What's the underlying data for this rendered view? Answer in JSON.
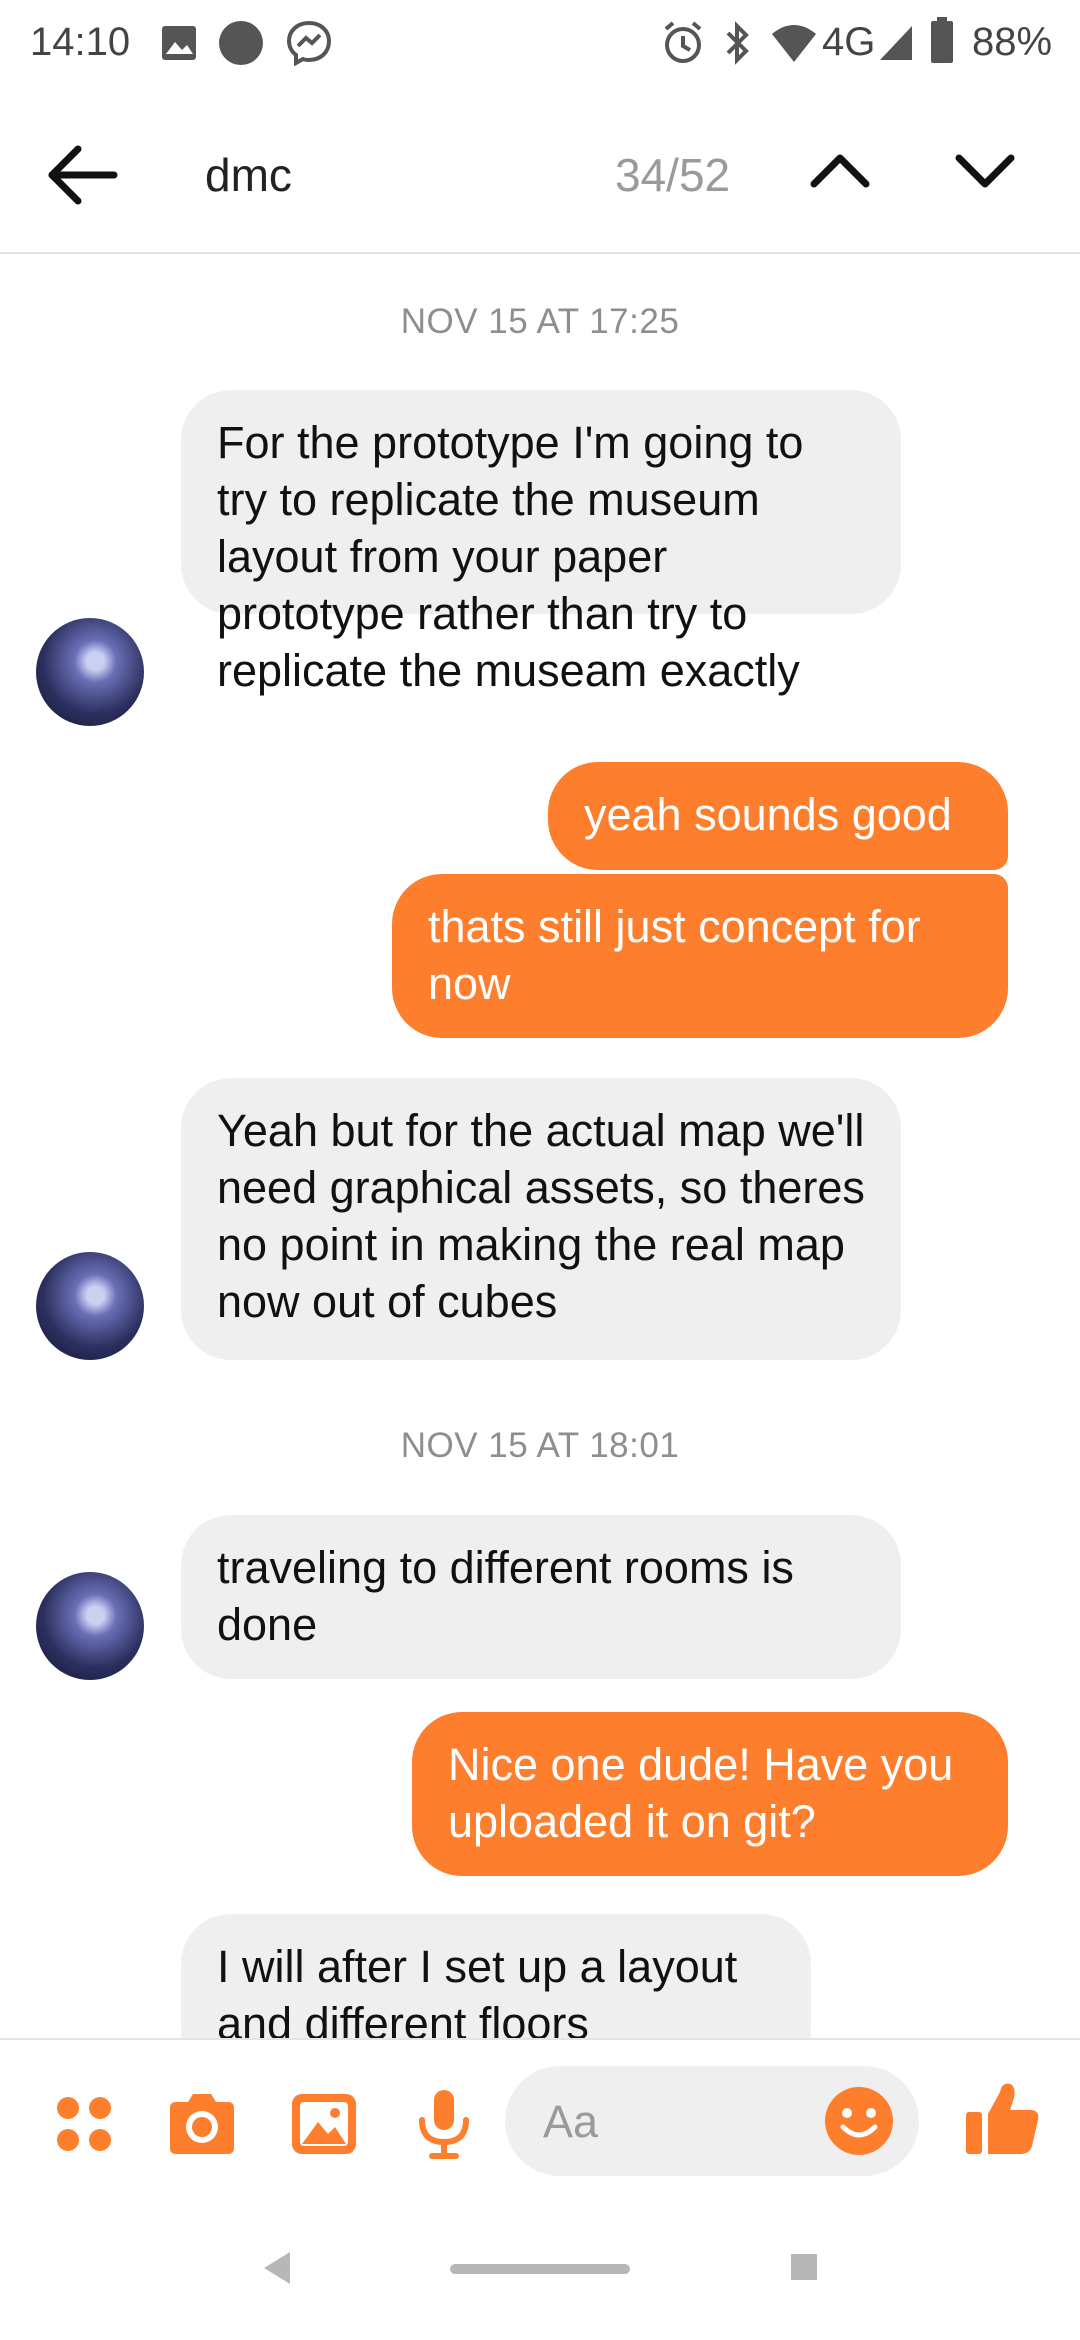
{
  "status_bar": {
    "time": "14:10",
    "network": "4G",
    "battery": "88%",
    "icons": [
      "image-icon",
      "circle-icon",
      "messenger-icon",
      "alarm-icon",
      "bluetooth-icon",
      "wifi-icon",
      "signal-icon",
      "battery-icon"
    ]
  },
  "header": {
    "search_query": "dmc",
    "match_counter": "34/52",
    "back_icon": "arrow-left-icon",
    "prev_icon": "chevron-up-icon",
    "next_icon": "chevron-down-icon"
  },
  "messages": [
    {
      "type": "timestamp",
      "text": "NOV 15 AT 17:25"
    },
    {
      "type": "incoming",
      "text": "For the prototype I'm going to try to replicate the museum layout from your paper prototype rather than try to replicate the museam exactly",
      "avatar": true
    },
    {
      "type": "outgoing",
      "text": "yeah sounds good"
    },
    {
      "type": "outgoing",
      "text": "thats still just concept for now"
    },
    {
      "type": "incoming",
      "text": "Yeah but for the actual map we'll need graphical assets, so theres no point in making the real map now out of cubes",
      "avatar": true
    },
    {
      "type": "timestamp",
      "text": "NOV 15 AT 18:01"
    },
    {
      "type": "incoming",
      "text": "traveling to different rooms is done",
      "avatar": true
    },
    {
      "type": "outgoing",
      "text": "Nice one dude! Have you uploaded it on git?"
    },
    {
      "type": "incoming",
      "text": "I will after I set up a layout and different floors",
      "avatar": false
    }
  ],
  "composer": {
    "placeholder": "Aa",
    "icons": [
      "apps-icon",
      "camera-icon",
      "gallery-icon",
      "microphone-icon",
      "emoji-icon",
      "thumbs-up-icon"
    ]
  },
  "colors": {
    "accent": "#fd7e2d",
    "incoming_bubble": "#efefef",
    "timestamp_text": "#8e8e8e"
  }
}
